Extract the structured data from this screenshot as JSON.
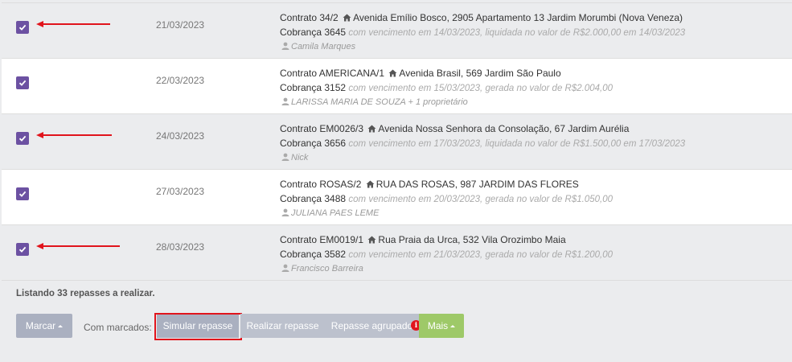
{
  "rows": [
    {
      "date": "21/03/2023",
      "contract": "Contrato 34/2",
      "address": "Avenida Emílio Bosco, 2905 Apartamento 13 Jardim Morumbi (Nova Veneza)",
      "charge": "Cobrança 3645",
      "charge_detail": "com vencimento em 14/03/2023, liquidada no valor de R$2.000,00 em 14/03/2023",
      "owner": "Camila Marques",
      "checked": true,
      "arrow": true
    },
    {
      "date": "22/03/2023",
      "contract": "Contrato AMERICANA/1",
      "address": "Avenida Brasil, 569 Jardim São Paulo",
      "charge": "Cobrança 3152",
      "charge_detail": "com vencimento em 15/03/2023, gerada no valor de R$2.004,00",
      "owner": "LARISSA MARIA DE SOUZA + 1 proprietário",
      "checked": true,
      "arrow": false
    },
    {
      "date": "24/03/2023",
      "contract": "Contrato EM0026/3",
      "address": "Avenida Nossa Senhora da Consolação, 67 Jardim Aurélia",
      "charge": "Cobrança 3656",
      "charge_detail": "com vencimento em 17/03/2023, liquidada no valor de R$1.500,00 em 17/03/2023",
      "owner": "Nick",
      "checked": true,
      "arrow": true
    },
    {
      "date": "27/03/2023",
      "contract": "Contrato ROSAS/2",
      "address": "RUA DAS ROSAS, 987 JARDIM DAS FLORES",
      "charge": "Cobrança 3488",
      "charge_detail": "com vencimento em 20/03/2023, gerada no valor de R$1.050,00",
      "owner": "JULIANA PAES LEME",
      "checked": true,
      "arrow": false
    },
    {
      "date": "28/03/2023",
      "contract": "Contrato EM0019/1",
      "address": "Rua Praia da Urca, 532 Vila Orozimbo Maia",
      "charge": "Cobrança 3582",
      "charge_detail": "com vencimento em 21/03/2023, gerada no valor de R$1.200,00",
      "owner": "Francisco Barreira",
      "checked": true,
      "arrow": true
    }
  ],
  "footer": {
    "listing_text": "Listando 33 repasses a realizar.",
    "marcar_label": "Marcar",
    "com_marcados_label": "Com marcados:",
    "simular_label": "Simular repasse",
    "realizar_label": "Realizar repasse",
    "agrupado_label": "Repasse agrupado",
    "alert_icon_text": "i",
    "mais_label": "Mais"
  },
  "colors": {
    "checkbox": "#6c51a2",
    "annotation_red": "#e1141c",
    "button_gray": "#aab0c0",
    "button_green": "#9ec968"
  }
}
